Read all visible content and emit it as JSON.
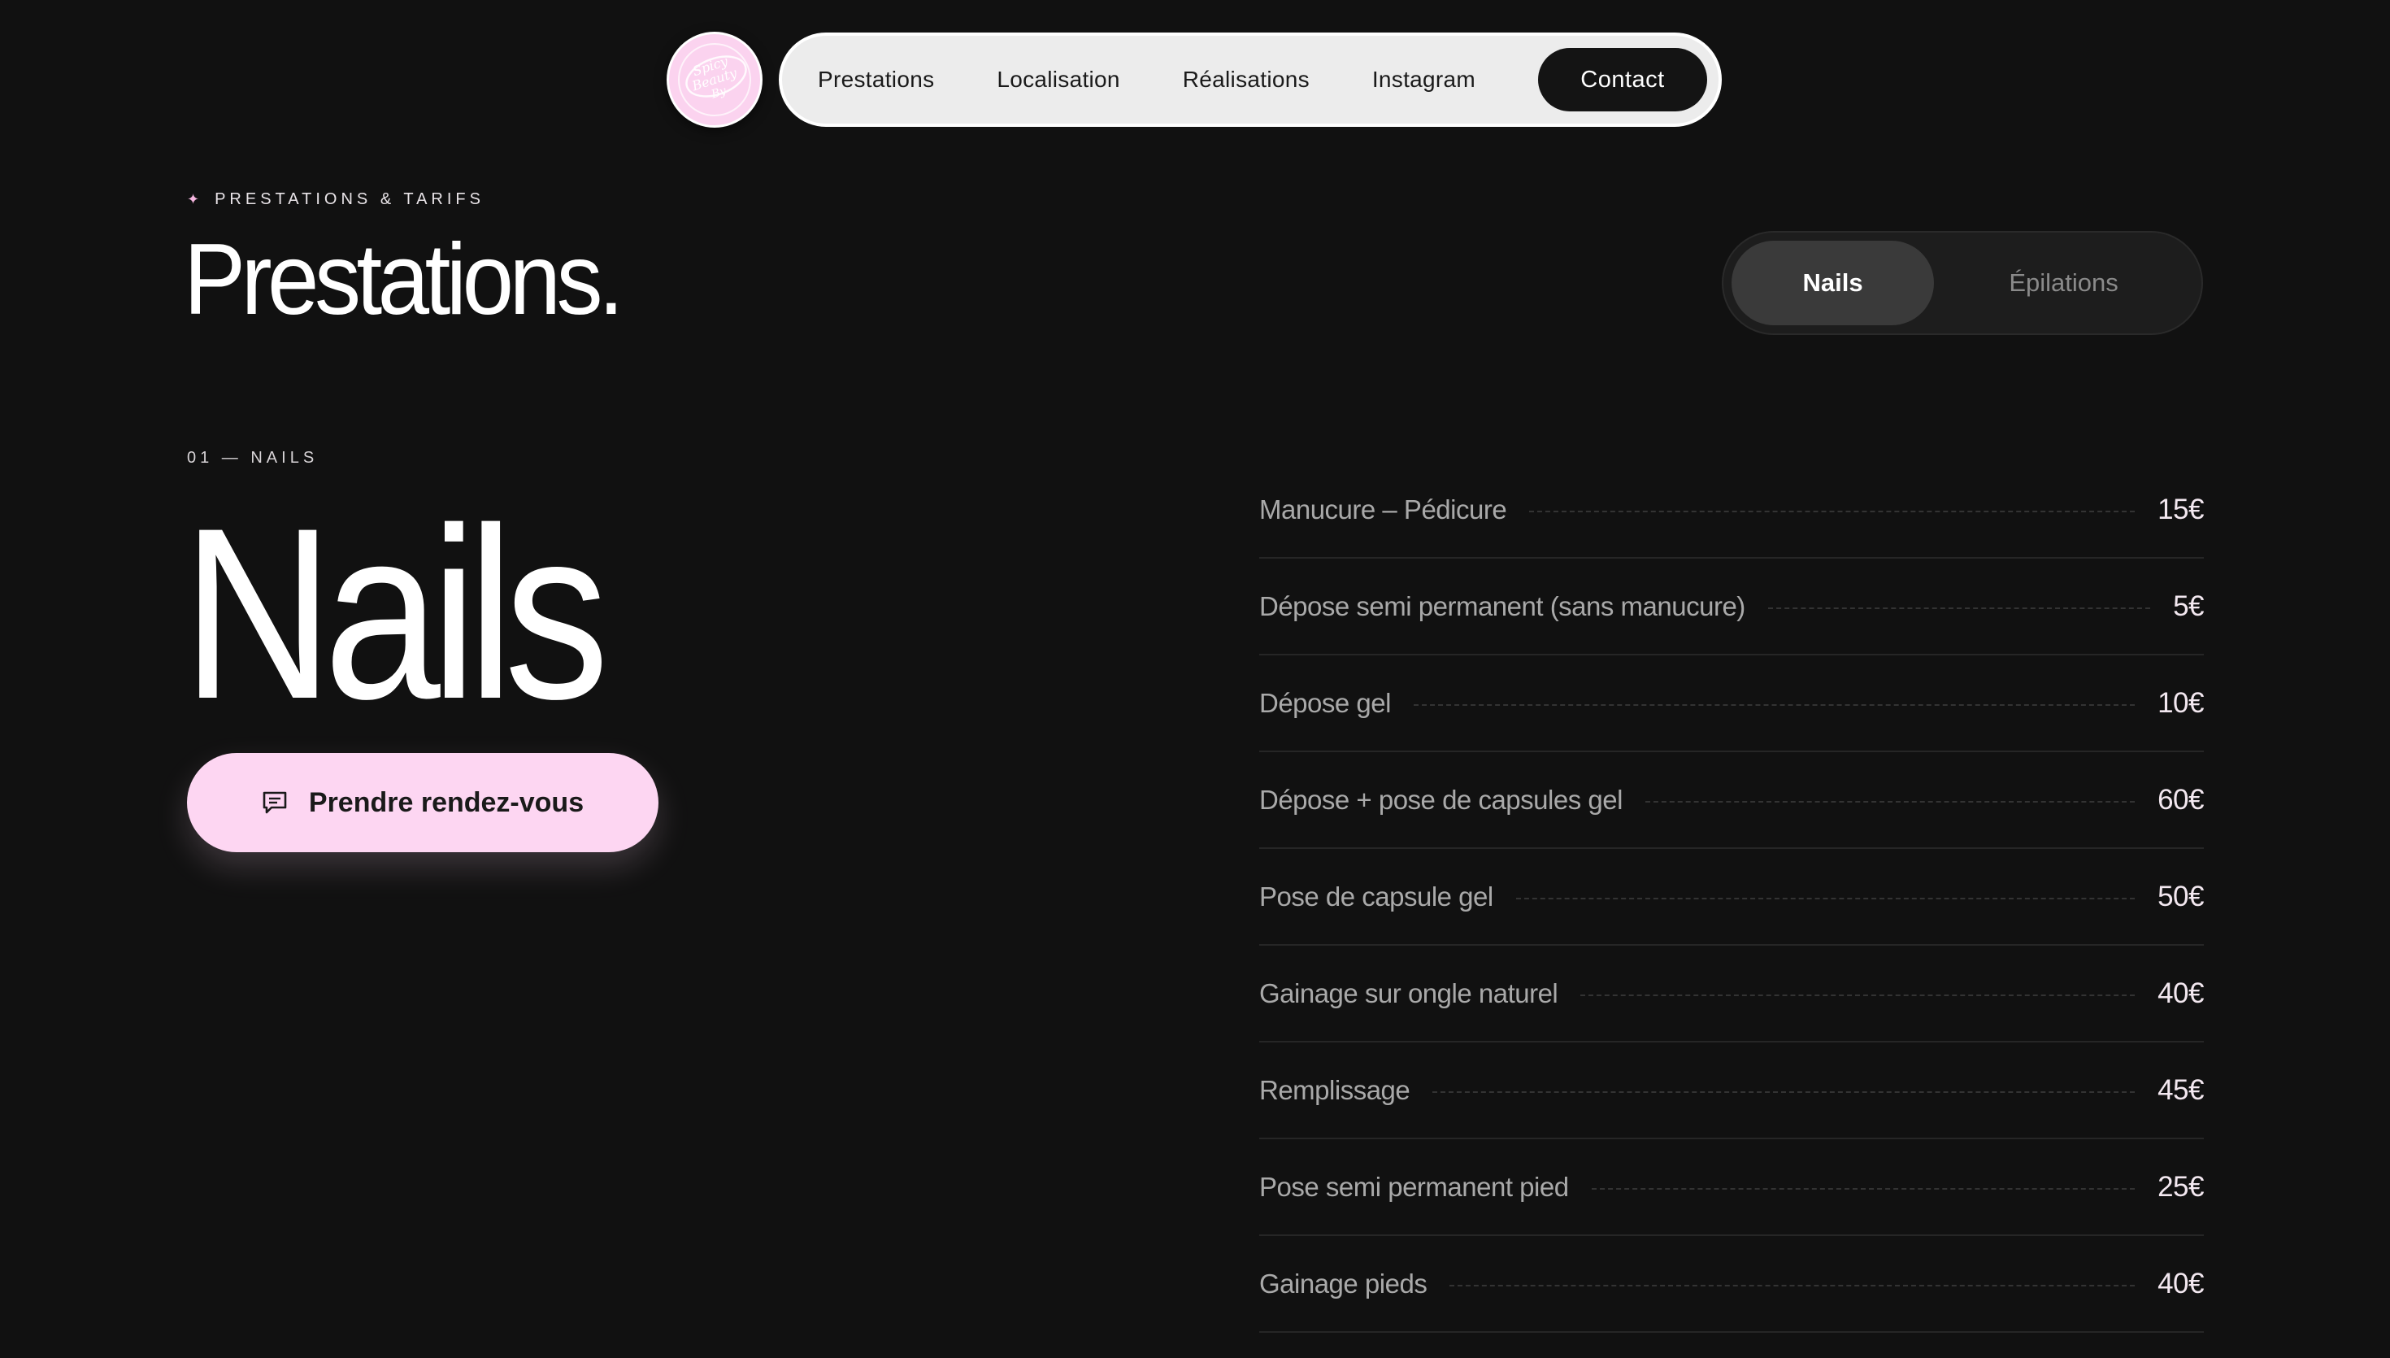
{
  "nav": {
    "logo_text": "Spicy Beauty By",
    "links": [
      {
        "label": "Prestations"
      },
      {
        "label": "Localisation"
      },
      {
        "label": "Réalisations"
      },
      {
        "label": "Instagram"
      }
    ],
    "contact_label": "Contact"
  },
  "header": {
    "eyebrow_icon": "sparkle-icon",
    "eyebrow": "PRESTATIONS & TARIFS",
    "title": "Prestations."
  },
  "toggle": {
    "active_label": "Nails",
    "inactive_label": "Épilations"
  },
  "section": {
    "number": "01 — NAILS",
    "title": "Nails",
    "cta_icon": "message-icon",
    "cta_label": "Prendre rendez-vous"
  },
  "prices": [
    {
      "name": "Manucure – Pédicure",
      "price": "15€"
    },
    {
      "name": "Dépose semi permanent (sans manucure)",
      "price": "5€"
    },
    {
      "name": "Dépose gel",
      "price": "10€"
    },
    {
      "name": "Dépose + pose de capsules gel",
      "price": "60€"
    },
    {
      "name": "Pose de capsule gel",
      "price": "50€"
    },
    {
      "name": "Gainage sur ongle naturel",
      "price": "40€"
    },
    {
      "name": "Remplissage",
      "price": "45€"
    },
    {
      "name": "Pose semi permanent pied",
      "price": "25€"
    },
    {
      "name": "Gainage pieds",
      "price": "40€"
    }
  ],
  "colors": {
    "background": "#111111",
    "accent_pink": "#fdd6f2",
    "nav_pill": "#ececec",
    "toggle_active": "#3a3a3a"
  }
}
